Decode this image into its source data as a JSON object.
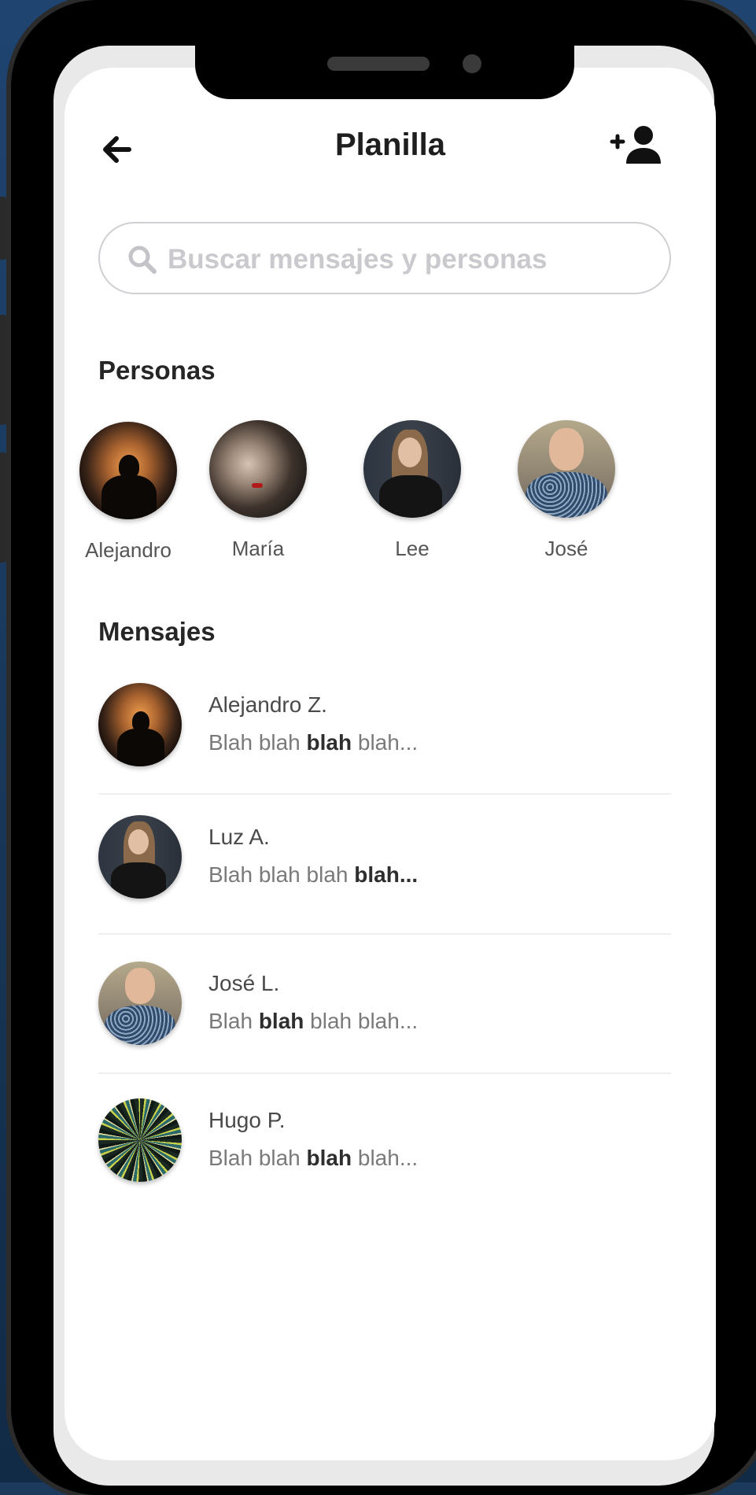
{
  "header": {
    "title": "Planilla",
    "back_icon": "arrow-left-icon",
    "add_icon": "add-person-icon"
  },
  "search": {
    "placeholder": "Buscar mensajes y personas",
    "value": ""
  },
  "people": {
    "section_title": "Personas",
    "items": [
      {
        "name": "Alejandro"
      },
      {
        "name": "María"
      },
      {
        "name": "Lee"
      },
      {
        "name": "José"
      }
    ]
  },
  "messages": {
    "section_title": "Mensajes",
    "items": [
      {
        "name": "Alejandro Z.",
        "p1": "Blah blah ",
        "bold": "blah",
        "p2": " blah..."
      },
      {
        "name": "Luz A.",
        "p1": "Blah blah blah ",
        "bold": "blah...",
        "p2": ""
      },
      {
        "name": "José L.",
        "p1": "Blah ",
        "bold": "blah",
        "p2": " blah blah..."
      },
      {
        "name": "Hugo P.",
        "p1": "Blah blah ",
        "bold": "blah",
        "p2": " blah..."
      }
    ]
  },
  "colors": {
    "background": "#1c3a5c",
    "phone_body": "#000000",
    "screen": "#ffffff",
    "text_primary": "#1e1e1e"
  }
}
